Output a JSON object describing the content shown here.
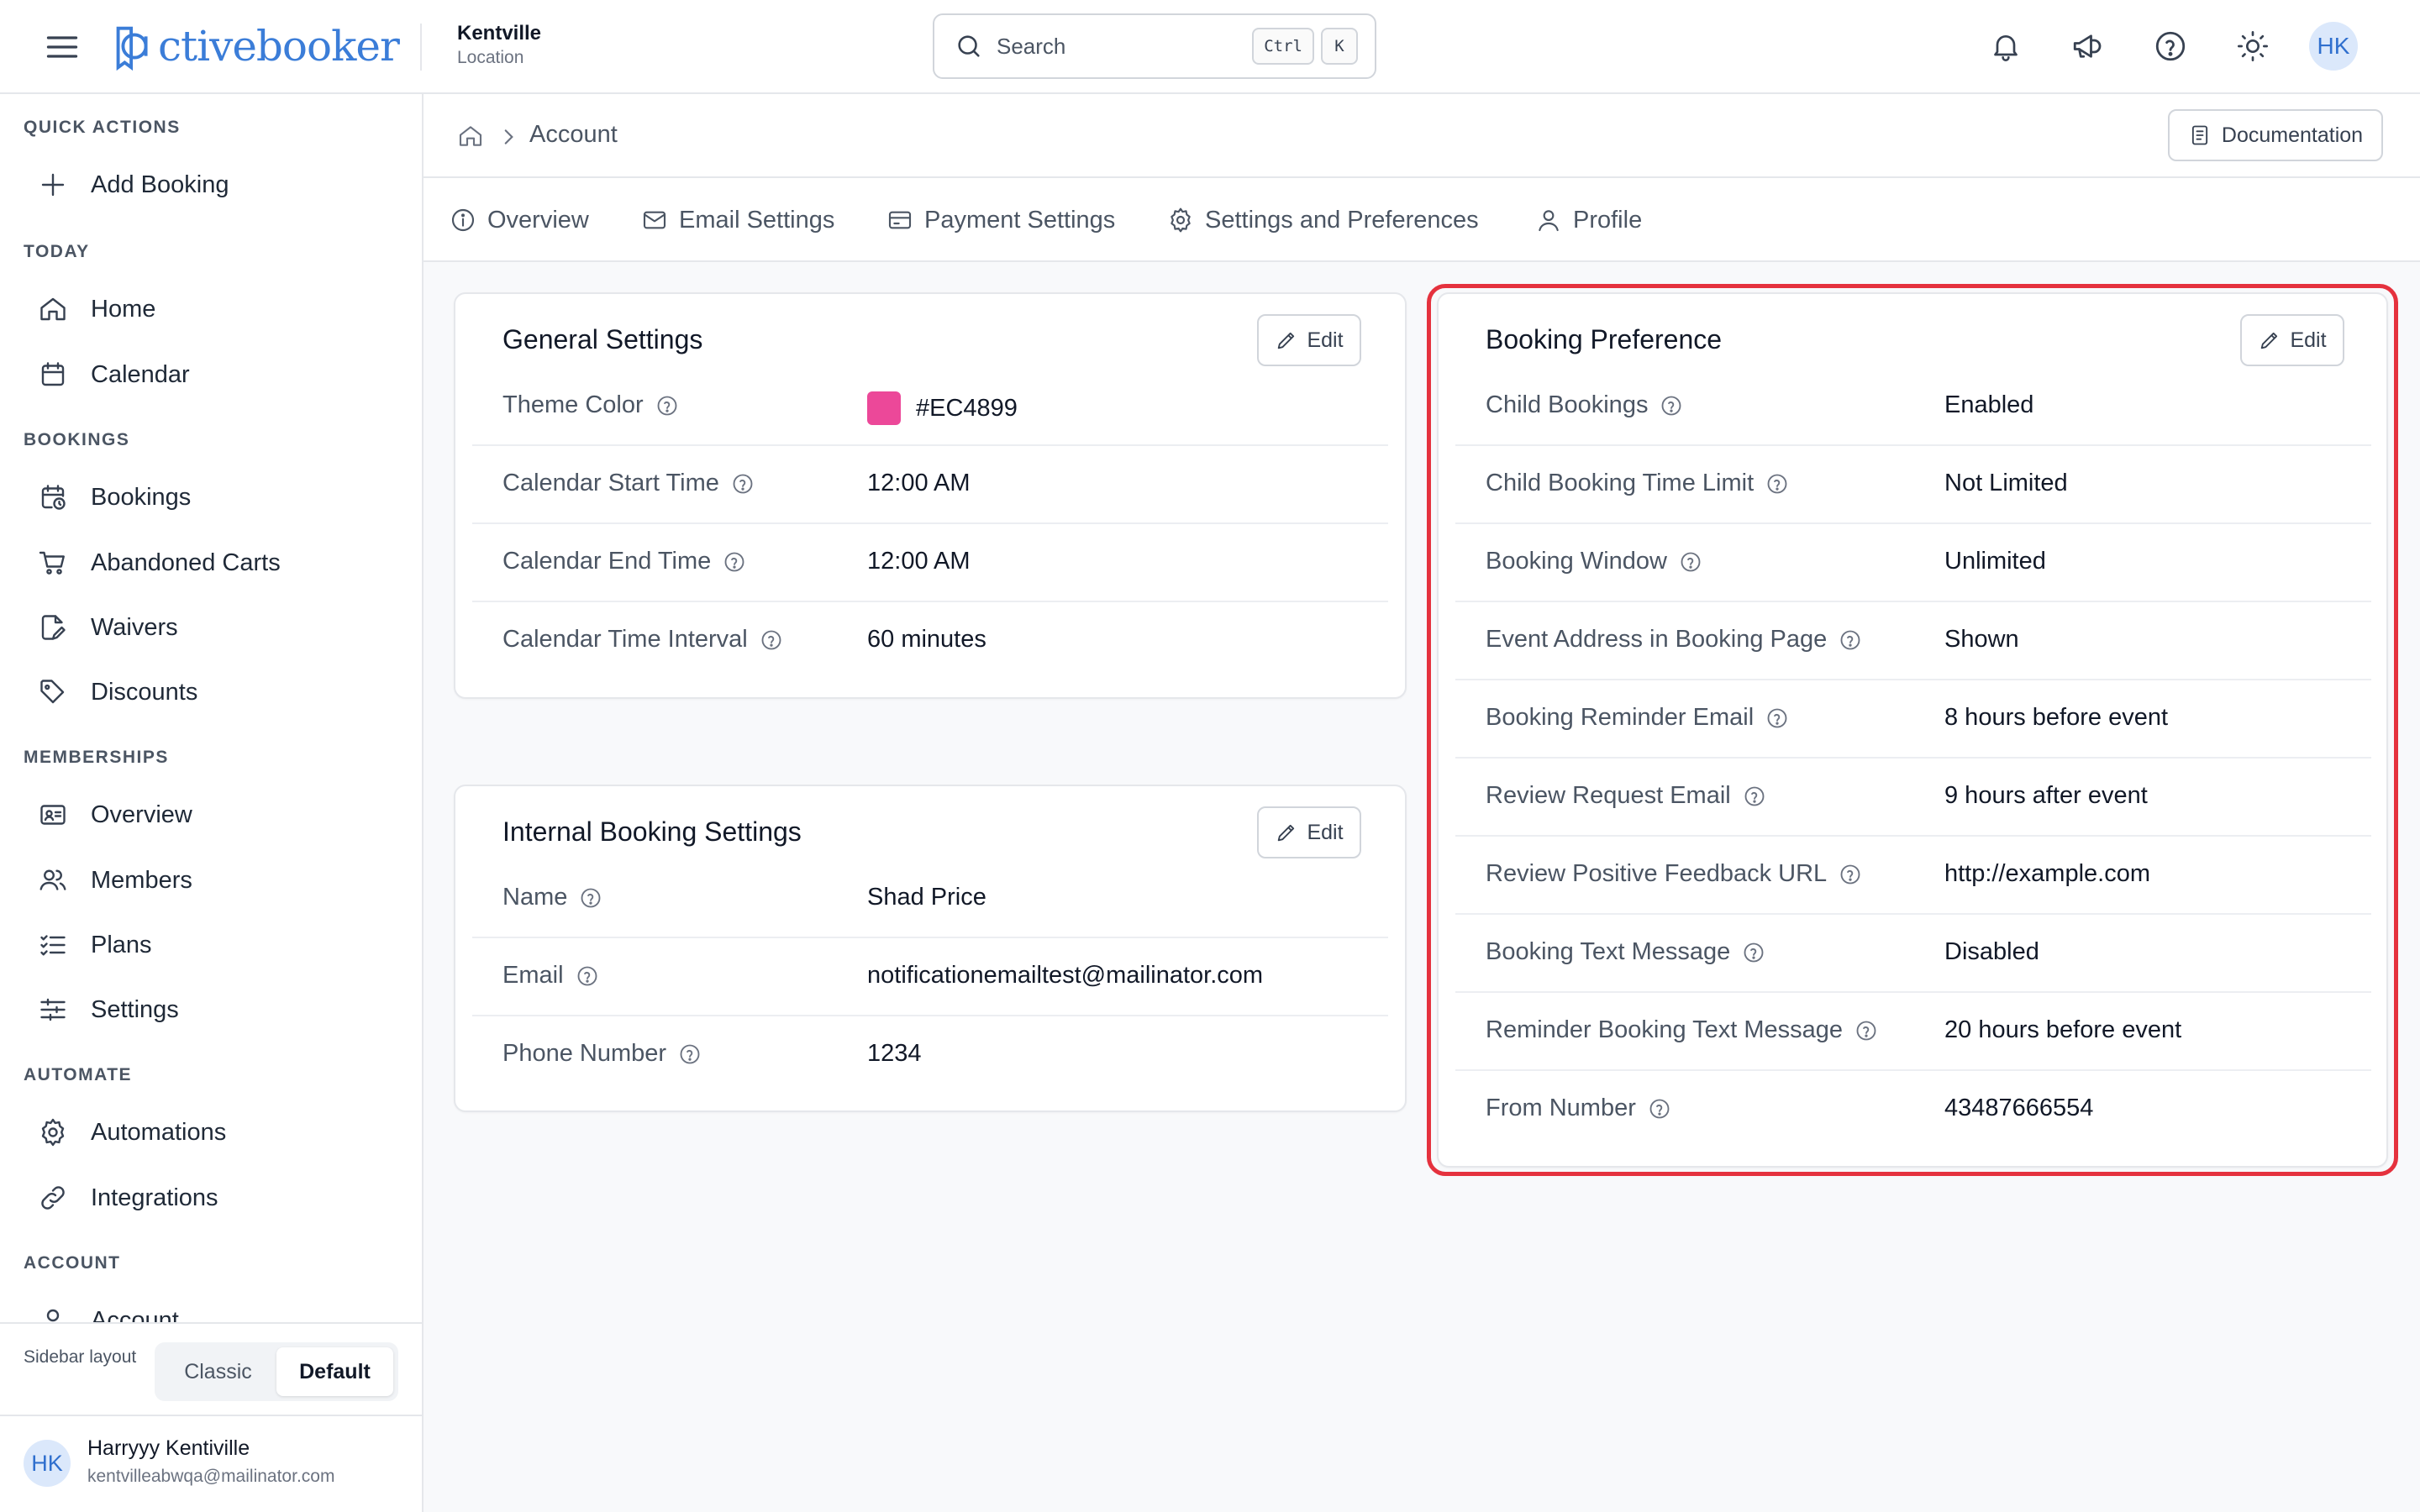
{
  "brand": {
    "logo_text": "ctivebooker",
    "accent": "#3b7dd8"
  },
  "location": {
    "name": "Kentville",
    "label": "Location"
  },
  "search": {
    "placeholder": "Search",
    "shortcut_key1": "Ctrl",
    "shortcut_key2": "K"
  },
  "header": {
    "avatar_initials": "HK",
    "icons": [
      "bell-icon",
      "megaphone-icon",
      "help-circle-icon",
      "sun-icon"
    ]
  },
  "sidebar": {
    "sections": {
      "quick_actions": "QUICK ACTIONS",
      "today": "TODAY",
      "bookings": "BOOKINGS",
      "memberships": "MEMBERSHIPS",
      "automate": "AUTOMATE",
      "account": "ACCOUNT"
    },
    "items": {
      "add_booking": "Add Booking",
      "home": "Home",
      "calendar": "Calendar",
      "bookings": "Bookings",
      "abandoned_carts": "Abandoned Carts",
      "waivers": "Waivers",
      "discounts": "Discounts",
      "overview": "Overview",
      "members": "Members",
      "plans": "Plans",
      "settings": "Settings",
      "automations": "Automations",
      "integrations": "Integrations",
      "account": "Account"
    },
    "layout_label": "Sidebar layout",
    "layout_options": [
      "Classic",
      "Default"
    ],
    "layout_selected": "Default",
    "user": {
      "initials": "HK",
      "name": "Harryyy Kentiville",
      "email": "kentvilleabwqa@mailinator.com"
    }
  },
  "breadcrumb": {
    "current": "Account"
  },
  "documentation_label": "Documentation",
  "tabs": [
    "Overview",
    "Email Settings",
    "Payment Settings",
    "Settings and Preferences",
    "Profile"
  ],
  "edit_label": "Edit",
  "general_settings": {
    "title": "General Settings",
    "rows": [
      {
        "label": "Theme Color",
        "value": "#EC4899",
        "swatch": "#EC4899"
      },
      {
        "label": "Calendar Start Time",
        "value": "12:00 AM"
      },
      {
        "label": "Calendar End Time",
        "value": "12:00 AM"
      },
      {
        "label": "Calendar Time Interval",
        "value": "60 minutes"
      }
    ]
  },
  "internal_booking_settings": {
    "title": "Internal Booking Settings",
    "rows": [
      {
        "label": "Name",
        "value": "Shad Price"
      },
      {
        "label": "Email",
        "value": "notificationemailtest@mailinator.com"
      },
      {
        "label": "Phone Number",
        "value": "1234"
      }
    ]
  },
  "booking_preference": {
    "title": "Booking Preference",
    "highlight_color": "#e5323e",
    "rows": [
      {
        "label": "Child Bookings",
        "value": "Enabled"
      },
      {
        "label": "Child Booking Time Limit",
        "value": "Not Limited"
      },
      {
        "label": "Booking Window",
        "value": "Unlimited"
      },
      {
        "label": "Event Address in Booking Page",
        "value": "Shown"
      },
      {
        "label": "Booking Reminder Email",
        "value": "8 hours before event"
      },
      {
        "label": "Review Request Email",
        "value": "9 hours after event"
      },
      {
        "label": "Review Positive Feedback URL",
        "value": "http://example.com"
      },
      {
        "label": "Booking Text Message",
        "value": "Disabled"
      },
      {
        "label": "Reminder Booking Text Message",
        "value": "20 hours before event"
      },
      {
        "label": "From Number",
        "value": "43487666554"
      }
    ]
  }
}
